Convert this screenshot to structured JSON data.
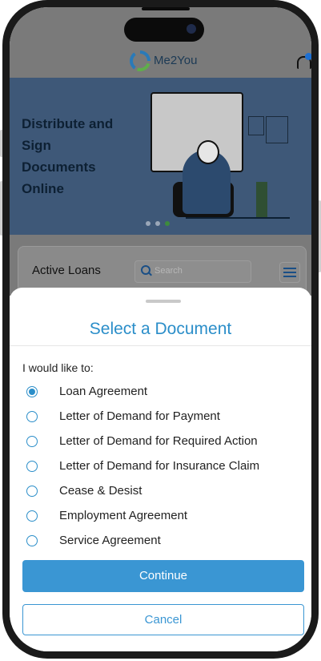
{
  "header": {
    "brand": "Me2You"
  },
  "banner": {
    "headline": "Distribute and Sign Documents Online"
  },
  "active_loans": {
    "title": "Active Loans",
    "search_placeholder": "Search"
  },
  "sheet": {
    "title": "Select a Document",
    "prompt": "I would like to:",
    "options": [
      {
        "label": "Loan Agreement",
        "selected": true
      },
      {
        "label": "Letter of Demand for Payment",
        "selected": false
      },
      {
        "label": "Letter of Demand for Required Action",
        "selected": false
      },
      {
        "label": "Letter of Demand for Insurance Claim",
        "selected": false
      },
      {
        "label": "Cease & Desist",
        "selected": false
      },
      {
        "label": "Employment Agreement",
        "selected": false
      },
      {
        "label": "Service Agreement",
        "selected": false
      }
    ],
    "continue_label": "Continue",
    "cancel_label": "Cancel"
  },
  "colors": {
    "accent": "#3a96d3",
    "banner_bg": "#3e5878",
    "overlay": "#7a7a7a"
  },
  "icons": {
    "bell": "bell-icon",
    "search": "search-icon",
    "filter": "filter-icon",
    "logo": "logo-icon"
  }
}
